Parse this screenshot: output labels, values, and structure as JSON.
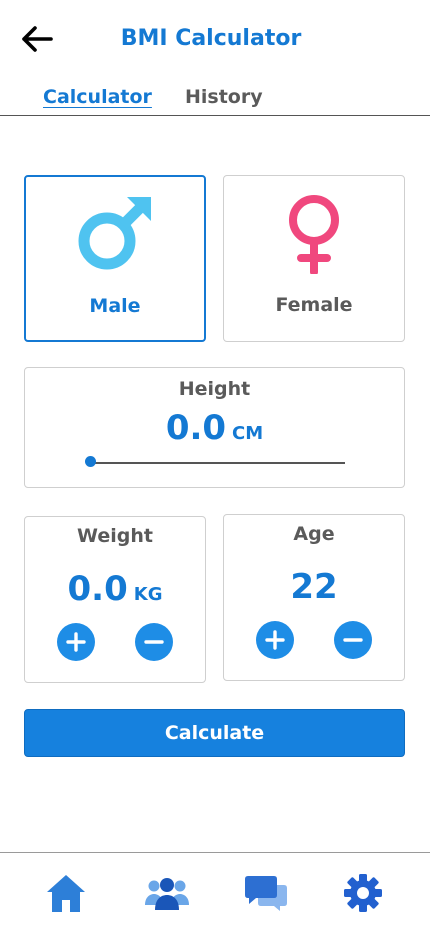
{
  "header": {
    "title": "BMI Calculator",
    "back_icon": "arrow-left-icon"
  },
  "tabs": [
    {
      "label": "Calculator",
      "active": true
    },
    {
      "label": "History",
      "active": false
    }
  ],
  "gender": {
    "male_label": "Male",
    "female_label": "Female",
    "selected": "Male",
    "male_color": "#4fc3f0",
    "female_color": "#f0487e"
  },
  "height": {
    "label": "Height",
    "value": "0.0",
    "unit": "CM",
    "slider_fraction": 0.0
  },
  "weight": {
    "label": "Weight",
    "value": "0.0",
    "unit": "KG"
  },
  "age": {
    "label": "Age",
    "value": "22"
  },
  "actions": {
    "calculate_label": "Calculate"
  },
  "bottom_nav": [
    {
      "icon": "home-icon"
    },
    {
      "icon": "users-icon"
    },
    {
      "icon": "chat-icon"
    },
    {
      "icon": "settings-icon"
    }
  ],
  "colors": {
    "accent": "#1479d3",
    "button": "#1681de"
  }
}
